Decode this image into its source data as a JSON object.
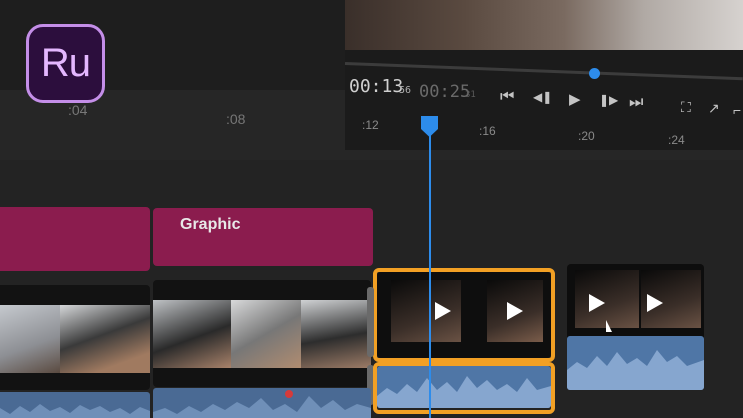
{
  "app": {
    "logo_text": "Ru"
  },
  "monitor": {
    "current_time": "00:13",
    "current_frames": "56",
    "duration_time": "00:25",
    "duration_frames": "31",
    "scrub_progress": 0.61,
    "buttons": [
      {
        "name": "go-to-start-icon",
        "glyph": "⏮"
      },
      {
        "name": "step-back-icon",
        "glyph": "◀❚"
      },
      {
        "name": "play-icon",
        "glyph": "▶"
      },
      {
        "name": "step-forward-icon",
        "glyph": "❚▶"
      },
      {
        "name": "go-to-end-icon",
        "glyph": "⏭"
      },
      {
        "name": "fit-frame-icon",
        "glyph": "⛶"
      },
      {
        "name": "export-frame-icon",
        "glyph": "↗"
      },
      {
        "name": "settings-icon",
        "glyph": "⌐"
      }
    ]
  },
  "ruler": {
    "ticks": [
      ":04",
      ":08",
      ":12",
      ":16",
      ":20",
      ":24"
    ]
  },
  "timeline": {
    "playhead_time": "00:13",
    "graphic_track": {
      "clip_label": "Graphic"
    }
  },
  "colors": {
    "accent_blue": "#2d8ceb",
    "selection_orange": "#f2a024",
    "graphic_clip": "#8b1c4e",
    "audio_clip": "#4a6a94",
    "logo_border": "#c48ee8"
  }
}
